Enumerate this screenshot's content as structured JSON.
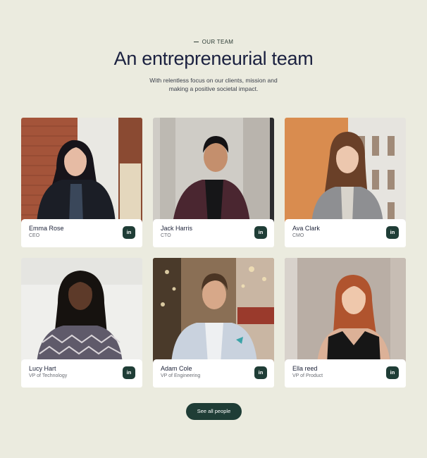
{
  "section": {
    "eyebrow": "OUR TEAM",
    "title": "An entrepreneurial team",
    "subtitle_line1": "With relentless focus on our clients, mission and",
    "subtitle_line2": "making a positive societal impact."
  },
  "team": [
    {
      "name": "Emma Rose",
      "role": "CEO",
      "linkedin_icon": "in"
    },
    {
      "name": "Jack Harris",
      "role": "CTO",
      "linkedin_icon": "in"
    },
    {
      "name": "Ava Clark",
      "role": "CMO",
      "linkedin_icon": "in"
    },
    {
      "name": "Lucy Hart",
      "role": "VP of Technology",
      "linkedin_icon": "in"
    },
    {
      "name": "Adam Cole",
      "role": "VP of Engineering",
      "linkedin_icon": "in"
    },
    {
      "name": "Ella reed",
      "role": "VP of Product",
      "linkedin_icon": "in"
    }
  ],
  "cta": {
    "label": "See all people"
  },
  "colors": {
    "background": "#ebebdf",
    "accent": "#1f3d36",
    "heading": "#1b2140"
  }
}
